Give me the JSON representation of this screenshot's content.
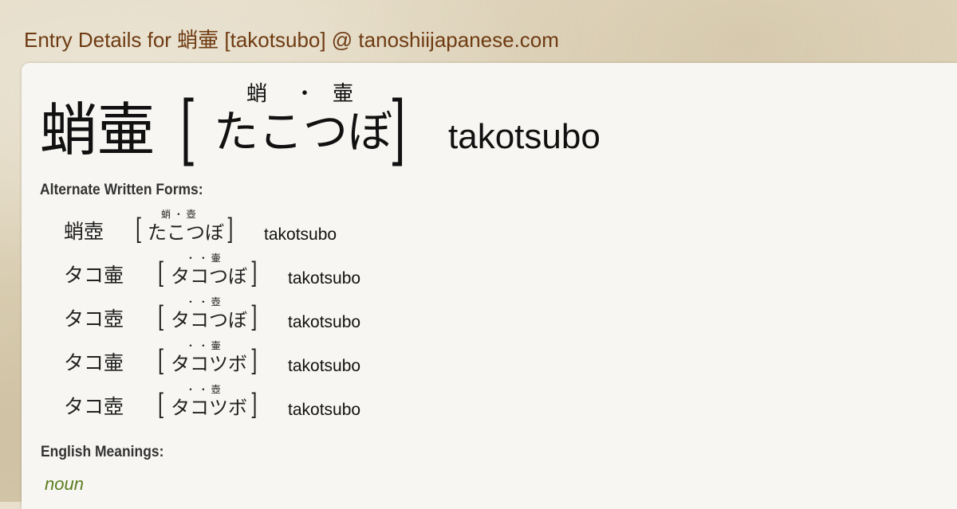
{
  "page": {
    "title": "Entry Details for 蛸壷 [takotsubo] @ tanoshiijapanese.com"
  },
  "main_entry": {
    "kanji": "蛸壷",
    "bracket_open": "[",
    "bracket_close": "]",
    "furigana_1": "蛸",
    "furigana_dot": "・",
    "furigana_2": "壷",
    "kana": "たこつぼ",
    "romaji": "takotsubo"
  },
  "alternate_forms": {
    "heading": "Alternate Written Forms:",
    "items": [
      {
        "word": "蛸壺",
        "furigana": "蛸 ・ 壺",
        "kana": "たこつぼ",
        "romaji": "takotsubo"
      },
      {
        "word": "タコ壷",
        "furigana": "・ ・ 壷",
        "kana": "タコつぼ",
        "romaji": "takotsubo"
      },
      {
        "word": "タコ壺",
        "furigana": "・ ・ 壺",
        "kana": "タコつぼ",
        "romaji": "takotsubo"
      },
      {
        "word": "タコ壷",
        "furigana": "・ ・ 壷",
        "kana": "タコツボ",
        "romaji": "takotsubo"
      },
      {
        "word": "タコ壺",
        "furigana": "・ ・ 壺",
        "kana": "タコツボ",
        "romaji": "takotsubo"
      }
    ]
  },
  "meanings": {
    "heading": "English Meanings:",
    "part_of_speech": "noun"
  },
  "colors": {
    "header_text": "#6e3b12",
    "card_background": "#f7f6f2",
    "part_of_speech": "#5a7d1e"
  }
}
